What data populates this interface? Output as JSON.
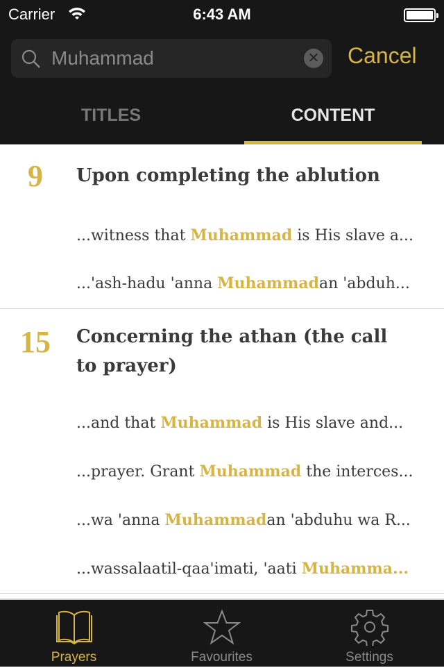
{
  "status": {
    "carrier": "Carrier",
    "time": "6:43 AM"
  },
  "search": {
    "value": "Muhammad",
    "cancel": "Cancel"
  },
  "tabs": [
    {
      "label": "TITLES",
      "active": false
    },
    {
      "label": "CONTENT",
      "active": true
    }
  ],
  "accent": "#d6b544",
  "results": [
    {
      "number": "9",
      "title": "Upon completing the ablution",
      "snippets": [
        {
          "pre": "...witness that ",
          "match": "Muhammad",
          "post": " is His slave a..."
        },
        {
          "pre": "...'ash-hadu 'anna ",
          "match": "Muhammad",
          "post": "an 'abduh..."
        }
      ]
    },
    {
      "number": "15",
      "title": "Concerning the athan (the call to prayer)",
      "snippets": [
        {
          "pre": "...and that ",
          "match": "Muhammad",
          "post": " is His slave and..."
        },
        {
          "pre": "...prayer. Grant ",
          "match": "Muhammad",
          "post": " the interces..."
        },
        {
          "pre": "...wa 'anna ",
          "match": "Muhammad",
          "post": "an 'abduhu wa R..."
        },
        {
          "pre": "...wassalaatil-qaa'imati, 'aati ",
          "match": "Muhamma...",
          "post": ""
        }
      ]
    }
  ],
  "tabbar": [
    {
      "label": "Prayers",
      "icon": "book-icon",
      "active": true
    },
    {
      "label": "Favourites",
      "icon": "star-icon",
      "active": false
    },
    {
      "label": "Settings",
      "icon": "gear-icon",
      "active": false
    }
  ]
}
